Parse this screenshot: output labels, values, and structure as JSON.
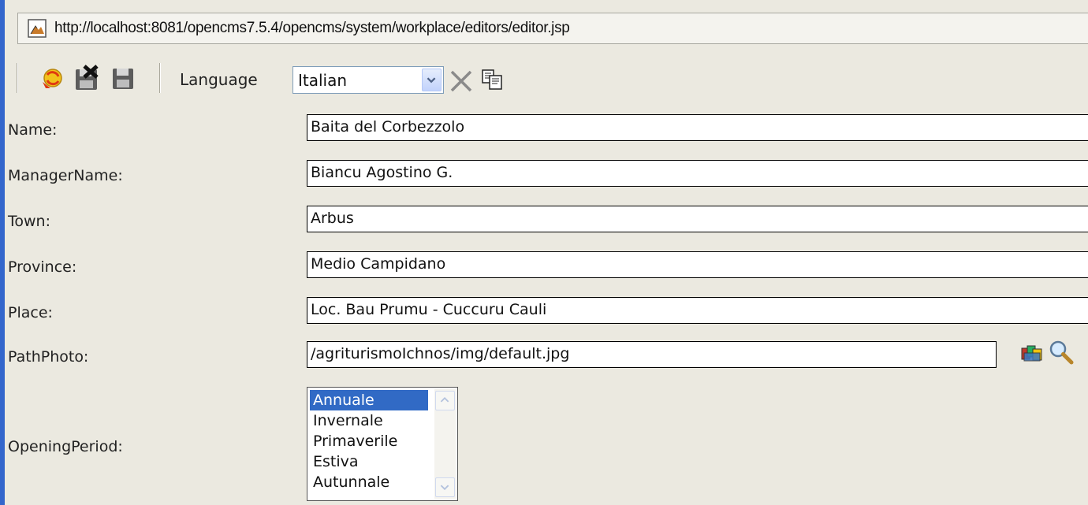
{
  "address_bar": {
    "url": "http://localhost:8081/opencms7.5.4/opencms/system/workplace/editors/editor.jsp",
    "icon": "page-image-icon"
  },
  "toolbar": {
    "buttons": [
      {
        "name": "publish-button",
        "icon": "publish-icon"
      },
      {
        "name": "save-and-exit-button",
        "icon": "save-exit-icon"
      },
      {
        "name": "save-button",
        "icon": "save-icon"
      }
    ],
    "language_label": "Language",
    "language_value": "Italian",
    "delete_locale_icon": "close-x-icon",
    "copy_locale_icon": "copy-icon"
  },
  "form": {
    "name_label": "Name:",
    "name_value": "Baita del Corbezzolo",
    "manager_label": "ManagerName:",
    "manager_value": "Biancu Agostino G.",
    "town_label": "Town:",
    "town_value": "Arbus",
    "province_label": "Province:",
    "province_value": "Medio Campidano",
    "place_label": "Place:",
    "place_value": "Loc. Bau Prumu - Cuccuru Cauli",
    "photo_label": "PathPhoto:",
    "photo_value": "/agriturismoIchnos/img/default.jpg",
    "photo_gallery_icon": "image-gallery-icon",
    "photo_preview_icon": "magnifier-icon",
    "period_label": "OpeningPeriod:",
    "period_options": [
      "Annuale",
      "Invernale",
      "Primaverile",
      "Estiva",
      "Autunnale"
    ],
    "period_selected": "Annuale"
  },
  "colors": {
    "background": "#ebe9e0",
    "selection": "#316ac5",
    "left_accent": "#3366cc"
  }
}
